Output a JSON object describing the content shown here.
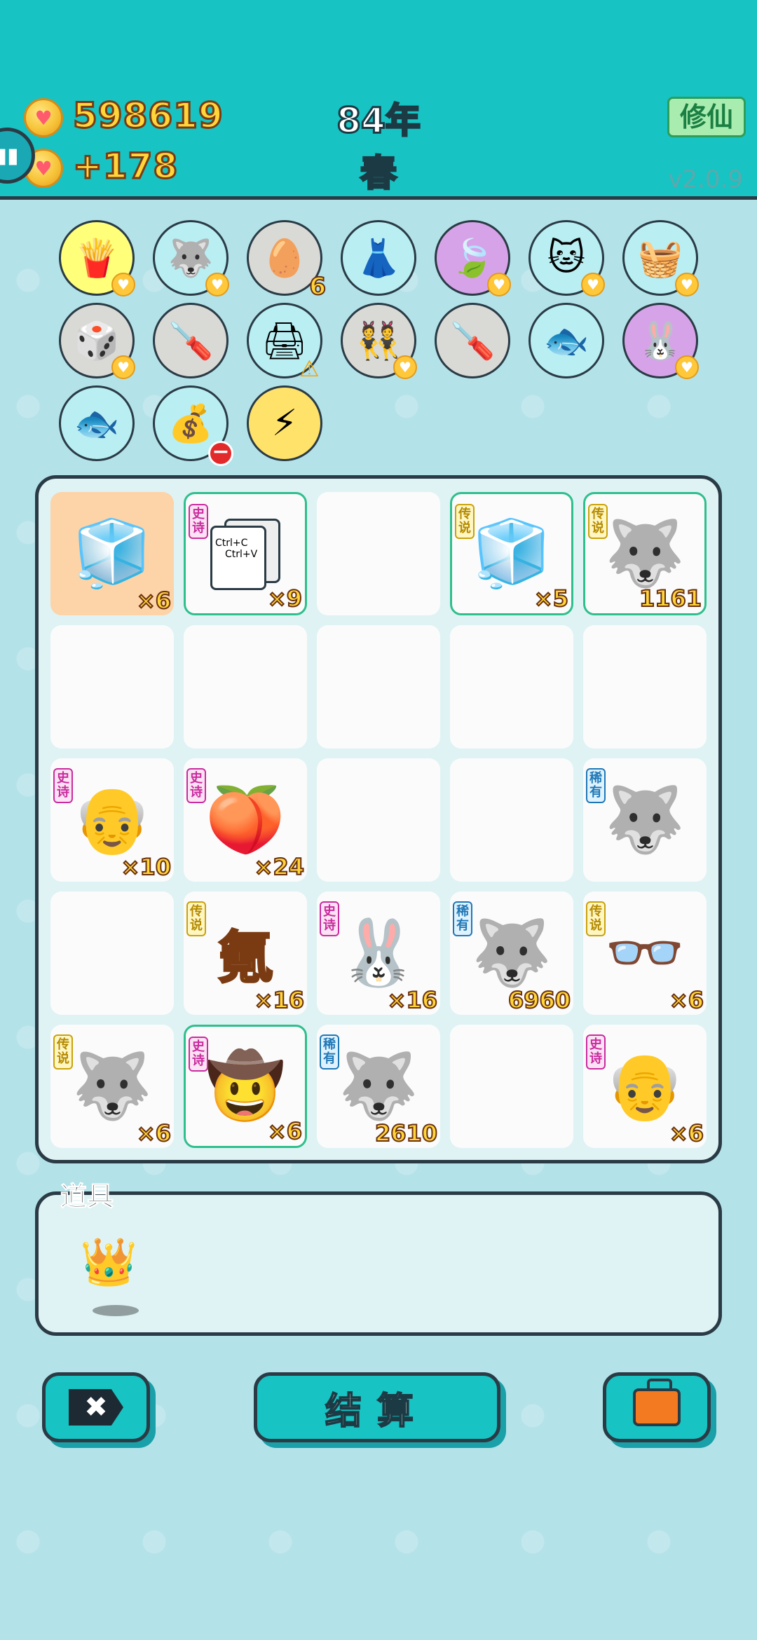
{
  "header": {
    "money": "598619",
    "income": "+178",
    "year": "84年",
    "season": "春",
    "xiuxian_label": "修仙",
    "version": "v2.0.9"
  },
  "items": [
    {
      "name": "fries",
      "icon": "🍟",
      "bg": "#ffff7a",
      "badge": "heart"
    },
    {
      "name": "husky-figure",
      "icon": "🐺",
      "bg": "#b9eef3",
      "badge": "heart"
    },
    {
      "name": "egg-tray",
      "icon": "🥚",
      "bg": "#d9d9d6",
      "badge": "count",
      "count": "6"
    },
    {
      "name": "pleated-skirt",
      "icon": "👗",
      "bg": "#b9eef3"
    },
    {
      "name": "leaf",
      "icon": "🍃",
      "bg": "#d7a3e8",
      "badge": "heart"
    },
    {
      "name": "cat",
      "icon": "🐱",
      "bg": "#b9eef3",
      "badge": "heart"
    },
    {
      "name": "fruit-basket",
      "icon": "🧺",
      "bg": "#b9eef3",
      "badge": "heart"
    },
    {
      "name": "dice",
      "icon": "🎲",
      "bg": "#d9d9d6",
      "badge": "heart"
    },
    {
      "name": "screwdriver",
      "icon": "🪛",
      "bg": "#d9d9d6"
    },
    {
      "name": "printer",
      "icon": "🖨",
      "bg": "#b9eef3",
      "badge": "warn"
    },
    {
      "name": "twins",
      "icon": "👯",
      "bg": "#d9d9d6",
      "badge": "heart"
    },
    {
      "name": "screwdriver",
      "icon": "🪛",
      "bg": "#d9d9d6"
    },
    {
      "name": "fishbowl",
      "icon": "🐟",
      "bg": "#b9eef3"
    },
    {
      "name": "rabbit",
      "icon": "🐰",
      "bg": "#d7a3e8",
      "badge": "heart"
    },
    {
      "name": "fishbowl",
      "icon": "🐟",
      "bg": "#b9eef3"
    },
    {
      "name": "money-bag",
      "icon": "💰",
      "bg": "#b9eef3",
      "badge": "minus"
    },
    {
      "name": "lightning",
      "icon": "⚡",
      "bg": "#ffe26a"
    }
  ],
  "grid": [
    {
      "icon": "🧊",
      "qty": "×6",
      "orange": true
    },
    {
      "copy": true,
      "tag": "史诗",
      "tag_type": "epic",
      "qty": "×9",
      "hl": true,
      "copy_line1": "Ctrl+C",
      "copy_line2": "Ctrl+V"
    },
    {},
    {
      "icon": "🧊",
      "tag": "传说",
      "tag_type": "legend",
      "qty": "×5",
      "hl": true
    },
    {
      "icon": "🐺",
      "tag": "传说",
      "tag_type": "legend",
      "qty": "1161",
      "hl": true
    },
    {},
    {},
    {},
    {},
    {},
    {
      "icon": "👴",
      "tag": "史诗",
      "tag_type": "epic",
      "qty": "×10"
    },
    {
      "icon": "🍑",
      "tag": "史诗",
      "tag_type": "epic",
      "qty": "×24"
    },
    {},
    {},
    {
      "icon": "🐺",
      "tag": "稀有",
      "tag_type": "rare"
    },
    {},
    {
      "char": "氪",
      "tag": "传说",
      "tag_type": "legend",
      "qty": "×16"
    },
    {
      "icon": "🐰",
      "tag": "史诗",
      "tag_type": "epic",
      "qty": "×16"
    },
    {
      "icon": "🐺",
      "tag": "稀有",
      "tag_type": "rare",
      "qty": "6960"
    },
    {
      "icon": "👓",
      "tag": "传说",
      "tag_type": "legend",
      "qty": "×6"
    },
    {
      "icon": "🐺",
      "tag": "传说",
      "tag_type": "legend",
      "qty": "×6"
    },
    {
      "icon": "🤠",
      "tag": "史诗",
      "tag_type": "epic",
      "qty": "×6",
      "hl": true
    },
    {
      "icon": "🐺",
      "tag": "稀有",
      "tag_type": "rare",
      "qty": "2610"
    },
    {},
    {
      "icon": "👴",
      "tag": "史诗",
      "tag_type": "epic",
      "qty": "×6"
    }
  ],
  "props": {
    "label": "道具",
    "crown_icon": "👑"
  },
  "buttons": {
    "close_icon": "✖",
    "settle_label": "结算",
    "bag_icon": "briefcase-icon"
  }
}
